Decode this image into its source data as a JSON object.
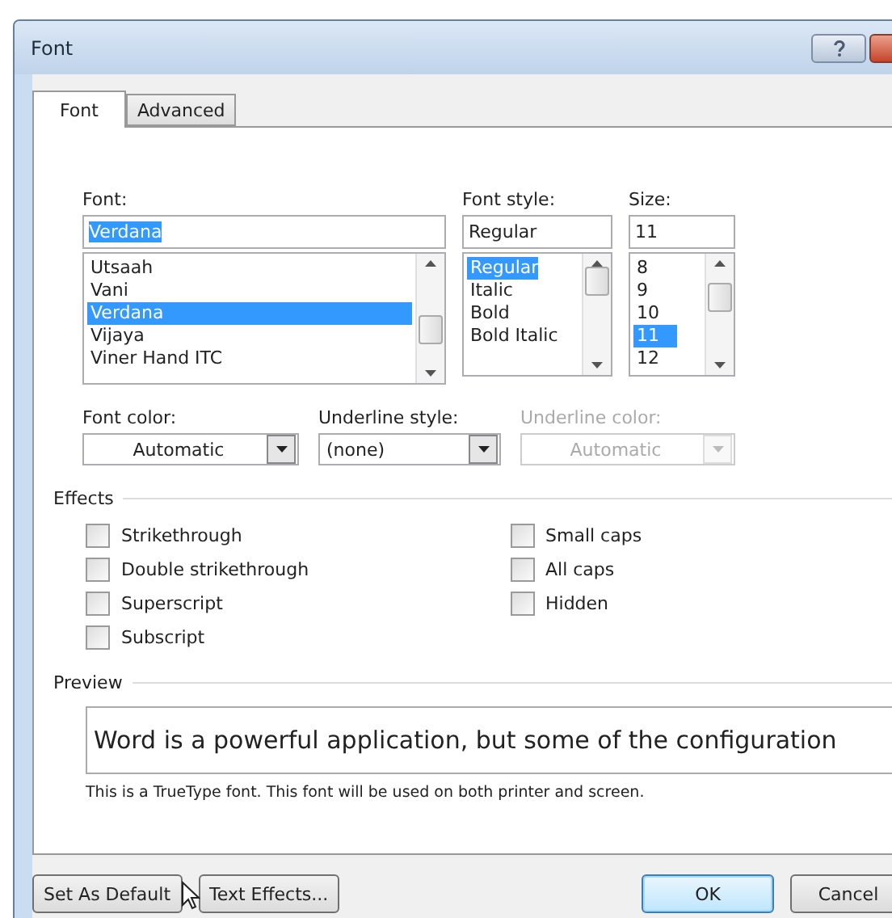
{
  "window": {
    "title": "Font"
  },
  "tabs": [
    {
      "label": "Font",
      "selected": true
    },
    {
      "label": "Advanced",
      "selected": false
    }
  ],
  "font": {
    "label": "Font:",
    "value": "Verdana",
    "items": [
      {
        "label": "Utsaah",
        "selected": false
      },
      {
        "label": "Vani",
        "selected": false
      },
      {
        "label": "Verdana",
        "selected": true
      },
      {
        "label": "Vijaya",
        "selected": false
      },
      {
        "label": "Viner Hand ITC",
        "selected": false
      }
    ]
  },
  "font_style": {
    "label": "Font style:",
    "value": "Regular",
    "items": [
      {
        "label": "Regular",
        "selected": true
      },
      {
        "label": "Italic",
        "selected": false
      },
      {
        "label": "Bold",
        "selected": false
      },
      {
        "label": "Bold Italic",
        "selected": false
      }
    ]
  },
  "size": {
    "label": "Size:",
    "value": "11",
    "items": [
      {
        "label": "8",
        "selected": false
      },
      {
        "label": "9",
        "selected": false
      },
      {
        "label": "10",
        "selected": false
      },
      {
        "label": "11",
        "selected": true
      },
      {
        "label": "12",
        "selected": false
      }
    ]
  },
  "dropdowns": [
    {
      "label": "Font color:",
      "value": "Automatic",
      "disabled": false,
      "centered": true
    },
    {
      "label": "Underline style:",
      "value": "(none)",
      "disabled": false,
      "centered": false
    },
    {
      "label": "Underline color:",
      "value": "Automatic",
      "disabled": true,
      "centered": true
    }
  ],
  "effects": {
    "title": "Effects",
    "left": [
      {
        "label": "Strikethrough",
        "checked": false
      },
      {
        "label": "Double strikethrough",
        "checked": false
      },
      {
        "label": "Superscript",
        "checked": false
      },
      {
        "label": "Subscript",
        "checked": false
      }
    ],
    "right": [
      {
        "label": "Small caps",
        "checked": false
      },
      {
        "label": "All caps",
        "checked": false
      },
      {
        "label": "Hidden",
        "checked": false
      }
    ]
  },
  "preview": {
    "title": "Preview",
    "sample": "Word is a powerful application, but some of the configuration",
    "note": "This is a TrueType font. This font will be used on both printer and screen."
  },
  "buttons": {
    "left": [
      {
        "label": "Set As Default",
        "focused": false
      },
      {
        "label": "Text Effects...",
        "focused": false
      }
    ],
    "right": [
      {
        "label": "OK",
        "focused": true
      },
      {
        "label": "Cancel",
        "focused": false
      }
    ]
  }
}
